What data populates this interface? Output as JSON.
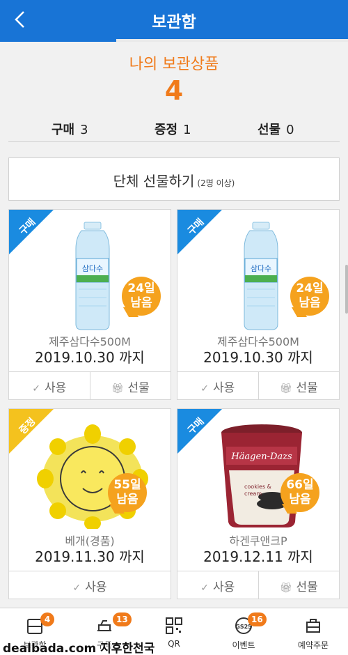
{
  "header": {
    "title": "보관함"
  },
  "summary": {
    "title": "나의 보관상품",
    "count": "4"
  },
  "stats": [
    {
      "label": "구매",
      "value": "3"
    },
    {
      "label": "증정",
      "value": "1"
    },
    {
      "label": "선물",
      "value": "0"
    }
  ],
  "group_gift": {
    "label": "단체 선물하기",
    "sub": "(2명 이상)"
  },
  "items": [
    {
      "tag": "구매",
      "remaining_line1": "24일",
      "remaining_line2": "남음",
      "name": "제주삼다수500M",
      "date": "2019.10.30 까지",
      "use_label": "사용",
      "gift_label": "선물"
    },
    {
      "tag": "구매",
      "remaining_line1": "24일",
      "remaining_line2": "남음",
      "name": "제주삼다수500M",
      "date": "2019.10.30 까지",
      "use_label": "사용",
      "gift_label": "선물"
    },
    {
      "tag": "증정",
      "remaining_line1": "55일",
      "remaining_line2": "남음",
      "name": "베개(경품)",
      "date": "2019.11.30 까지",
      "use_label": "사용"
    },
    {
      "tag": "구매",
      "remaining_line1": "66일",
      "remaining_line2": "남음",
      "name": "하겐쿠앤크P",
      "date": "2019.12.11 까지",
      "use_label": "사용",
      "gift_label": "선물"
    }
  ],
  "colors": {
    "header": "#1874d6",
    "accent": "#f07a1a",
    "ribbon_buy": "#1a8be0",
    "ribbon_free": "#f4c21e",
    "badge": "#f5a21e"
  },
  "bottom_nav": [
    {
      "label": "보관함",
      "badge": "4",
      "icon": "storage-icon"
    },
    {
      "label": "구독",
      "badge": "13",
      "icon": "subscription-icon"
    },
    {
      "label": "QR",
      "icon": "qr-icon"
    },
    {
      "label": "이벤트",
      "badge": "16",
      "icon": "gs25-event-icon"
    },
    {
      "label": "예약주문",
      "icon": "reservation-icon"
    }
  ],
  "watermark": "dealbada.com 지후한천국"
}
